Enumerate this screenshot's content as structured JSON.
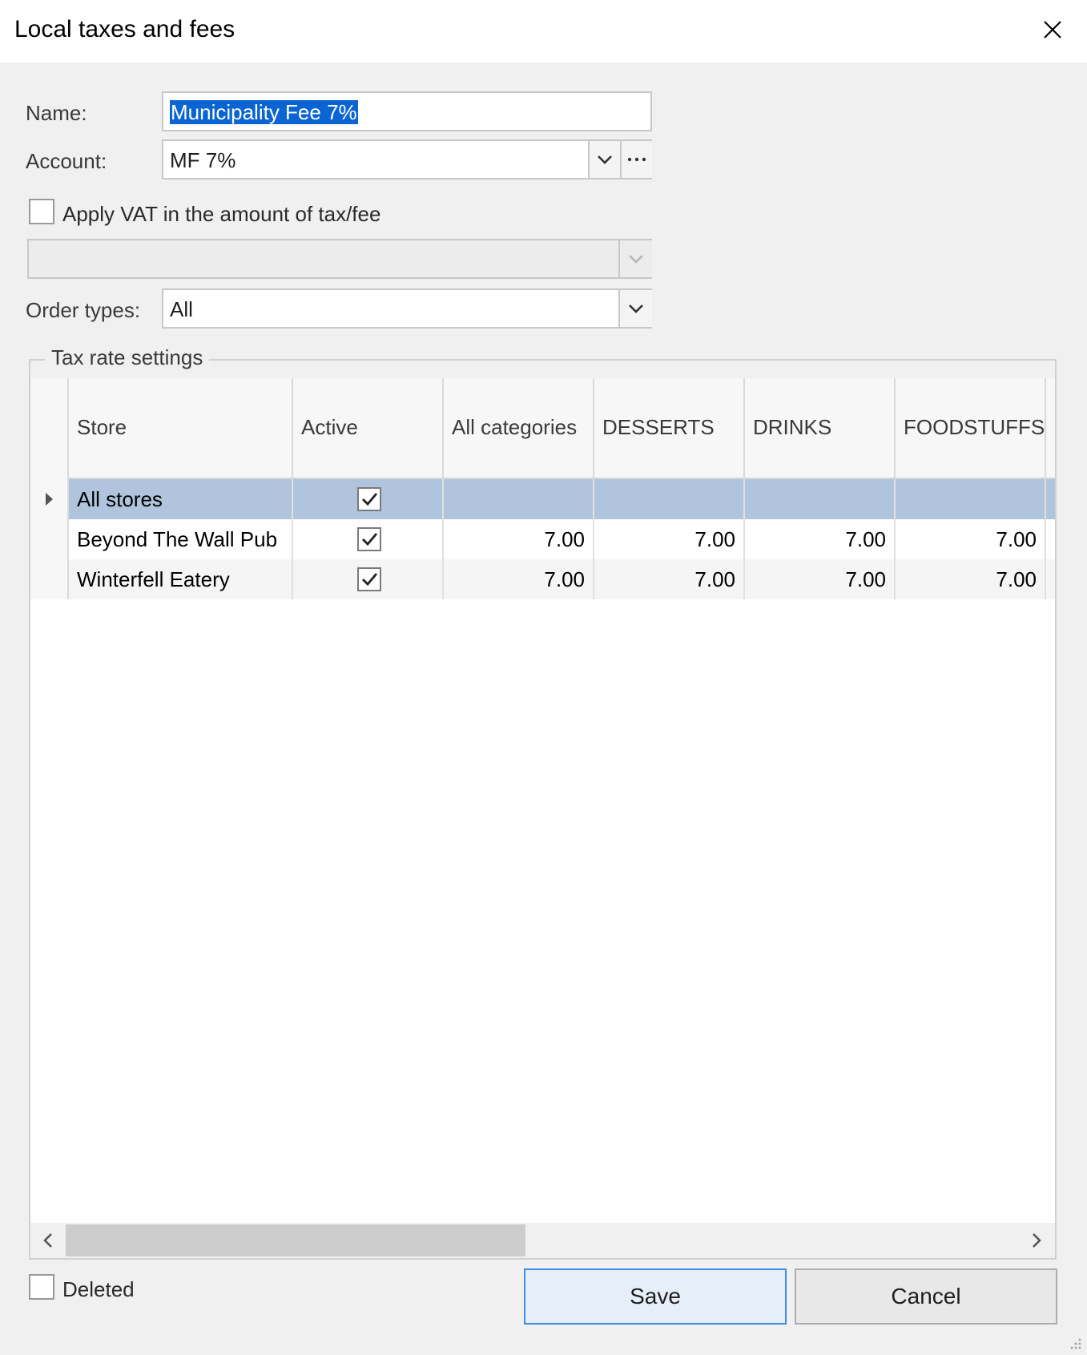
{
  "window": {
    "title": "Local taxes and fees"
  },
  "form": {
    "name_label": "Name:",
    "name_value": "Municipality Fee 7%",
    "account_label": "Account:",
    "account_value": "MF 7%",
    "vat_checkbox_label": "Apply VAT in the amount of tax/fee",
    "vat_checked": false,
    "vat_select_value": "",
    "order_types_label": "Order types:",
    "order_types_value": "All"
  },
  "tax_rate_settings": {
    "legend": "Tax rate settings",
    "columns": [
      "Store",
      "Active",
      "All categories",
      "DESSERTS",
      "DRINKS",
      "FOODSTUFFS"
    ],
    "rows": [
      {
        "store": "All stores",
        "active": true,
        "values": [
          "",
          "",
          "",
          ""
        ],
        "selected": true
      },
      {
        "store": "Beyond The Wall Pub",
        "active": true,
        "values": [
          "7.00",
          "7.00",
          "7.00",
          "7.00"
        ],
        "selected": false
      },
      {
        "store": "Winterfell Eatery",
        "active": true,
        "values": [
          "7.00",
          "7.00",
          "7.00",
          "7.00"
        ],
        "selected": false
      }
    ]
  },
  "footer": {
    "deleted_label": "Deleted",
    "deleted_checked": false,
    "save_label": "Save",
    "cancel_label": "Cancel"
  },
  "icons": {
    "close": "close-icon",
    "dropdown": "chevron-down-icon",
    "ellipsis": "ellipsis-icon",
    "check": "checkmark-icon",
    "row_pointer": "triangle-right-icon"
  },
  "colors": {
    "selection_highlight": "#0a64d2",
    "selected_row": "#b0c4de",
    "default_button_border": "#3c8ee3"
  }
}
